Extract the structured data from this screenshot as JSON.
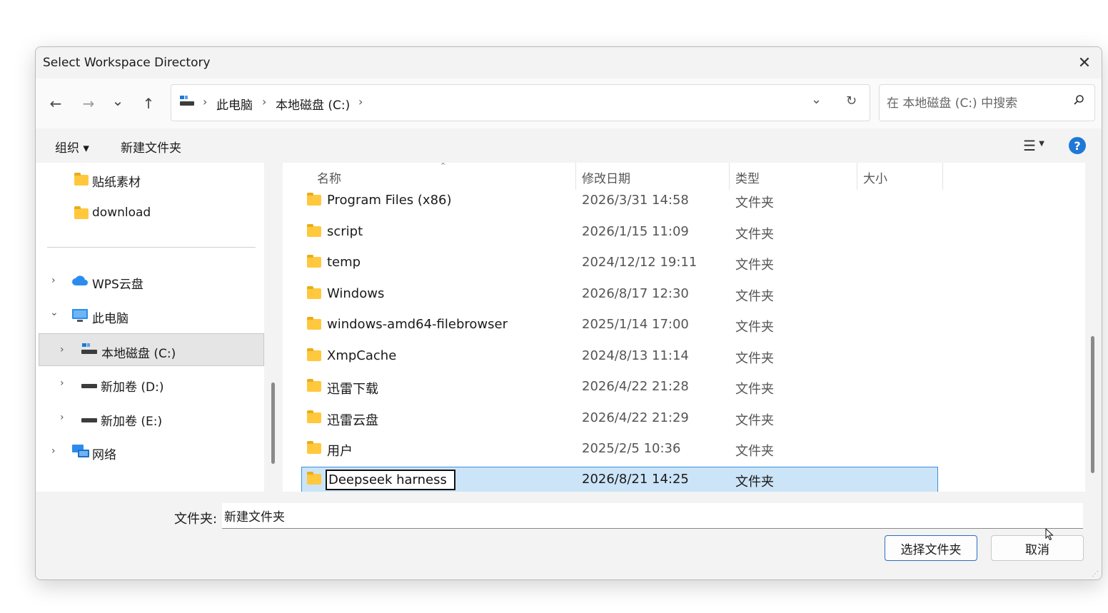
{
  "window": {
    "title": "Select Workspace Directory"
  },
  "nav": {
    "back_glyph": "←",
    "forward_glyph": "→",
    "recent_glyph": "⌄",
    "up_glyph": "↑"
  },
  "address": {
    "crumbs": [
      "此电脑",
      "本地磁盘 (C:)"
    ],
    "separator": "›"
  },
  "search": {
    "placeholder": "在 本地磁盘 (C:) 中搜索"
  },
  "toolbar": {
    "organize_label": "组织 ▾",
    "new_folder_label": "新建文件夹",
    "help_glyph": "?"
  },
  "sidebar": {
    "items": [
      {
        "label": "贴纸素材",
        "icon": "folder-icon"
      },
      {
        "label": "download",
        "icon": "folder-icon"
      },
      {
        "label": "WPS云盘",
        "icon": "cloud-icon"
      },
      {
        "label": "此电脑",
        "icon": "computer-icon"
      },
      {
        "label": "本地磁盘 (C:)",
        "icon": "drive-icon"
      },
      {
        "label": "新加卷 (D:)",
        "icon": "drive-icon"
      },
      {
        "label": "新加卷 (E:)",
        "icon": "drive-icon"
      },
      {
        "label": "网络",
        "icon": "network-icon"
      }
    ]
  },
  "columns": {
    "name": "名称",
    "date": "修改日期",
    "type": "类型",
    "size": "大小"
  },
  "files": [
    {
      "name": "Program Files (x86)",
      "date": "2026/3/31 14:58",
      "type": "文件夹"
    },
    {
      "name": "script",
      "date": "2026/1/15 11:09",
      "type": "文件夹"
    },
    {
      "name": "temp",
      "date": "2024/12/12 19:11",
      "type": "文件夹"
    },
    {
      "name": "Windows",
      "date": "2026/8/17 12:30",
      "type": "文件夹"
    },
    {
      "name": "windows-amd64-filebrowser",
      "date": "2025/1/14 17:00",
      "type": "文件夹"
    },
    {
      "name": "XmpCache",
      "date": "2024/8/13 11:14",
      "type": "文件夹"
    },
    {
      "name": "迅雷下载",
      "date": "2026/4/22 21:28",
      "type": "文件夹"
    },
    {
      "name": "迅雷云盘",
      "date": "2026/4/22 21:29",
      "type": "文件夹"
    },
    {
      "name": "用户",
      "date": "2025/2/5 10:36",
      "type": "文件夹"
    }
  ],
  "renaming": {
    "value": "Deepseek harness",
    "date": "2026/8/21 14:25",
    "type": "文件夹"
  },
  "footer": {
    "folder_label": "文件夹:",
    "folder_value": "新建文件夹",
    "select_label": "选择文件夹",
    "cancel_label": "取消"
  },
  "colors": {
    "accent": "#1e78d7",
    "selection_bg": "#cce4f7",
    "selection_border": "#3b8ede",
    "folder": "#ffc83d"
  }
}
